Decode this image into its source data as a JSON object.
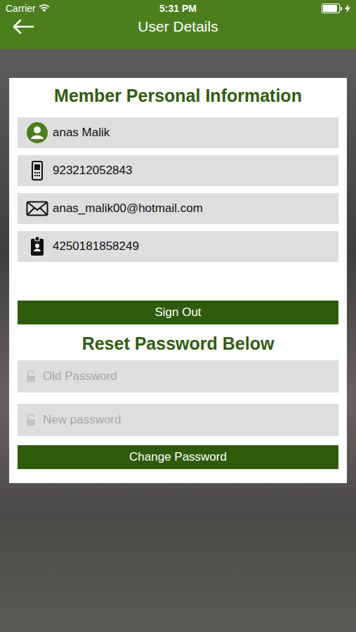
{
  "status_bar": {
    "carrier": "Carrier",
    "time": "5:31 PM",
    "battery_level": 1,
    "charging": true
  },
  "nav": {
    "title": "User Details"
  },
  "profile": {
    "title": "Member Personal Information",
    "fields": [
      {
        "kind": "name",
        "value": "anas Malik"
      },
      {
        "kind": "phone",
        "value": "923212052843"
      },
      {
        "kind": "email",
        "value": "anas_malik00@hotmail.com"
      },
      {
        "kind": "id",
        "value": "4250181858249"
      }
    ]
  },
  "sign_out": "Sign Out",
  "reset": {
    "title": "Reset Password Below",
    "fields": [
      {
        "placeholder": "Old Password"
      },
      {
        "placeholder": "New password"
      }
    ],
    "button": "Change Password"
  }
}
